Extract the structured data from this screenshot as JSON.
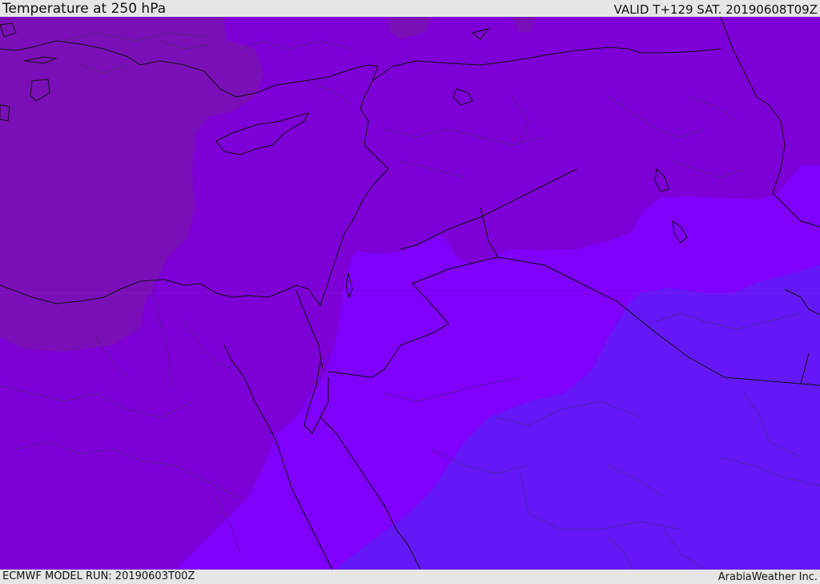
{
  "header": {
    "title": "Temperature at 250 hPa",
    "valid": "VALID T+129 SAT. 20190608T09Z"
  },
  "footer": {
    "model_run": "ECMWF MODEL RUN: 20190603T00Z",
    "credit": "ArabiaWeather Inc."
  },
  "map": {
    "field": "temperature-250hPa",
    "colors": {
      "band_warmest": "#7a0fb8",
      "band_warm": "#7d00d7",
      "band_mid": "#7f00fb",
      "band_cool": "#6418f8",
      "coastline": "#111111",
      "border": "#111111",
      "internal_border": "#333333"
    }
  }
}
